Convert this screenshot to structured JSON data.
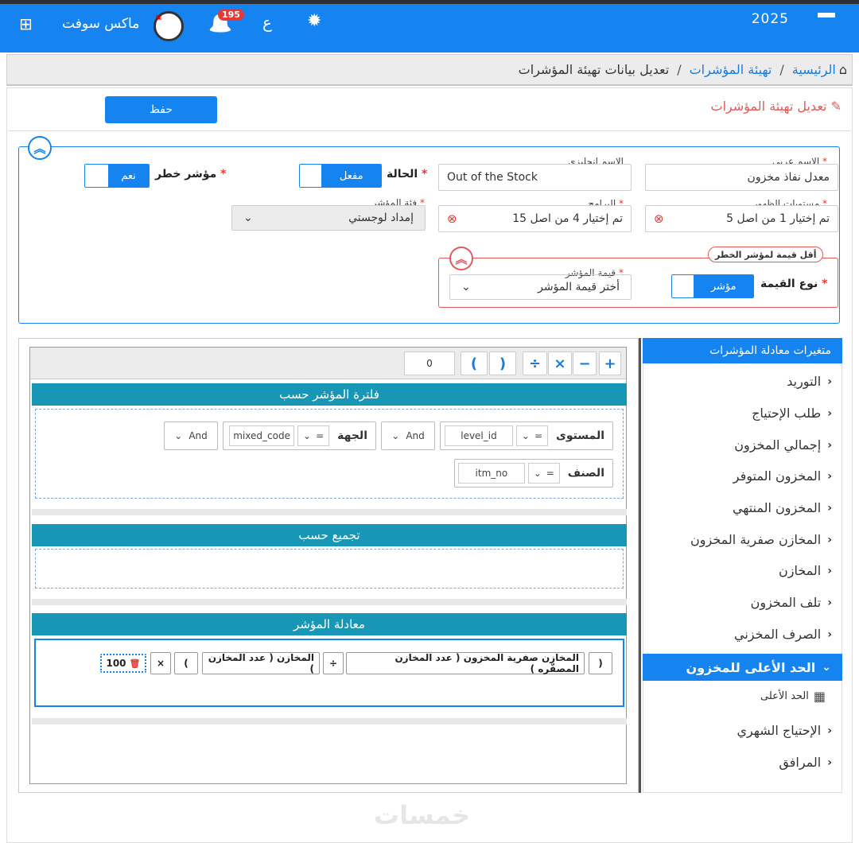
{
  "topbar": {
    "year": "2025",
    "brand": "ماكس سوفت",
    "notification_count": "195",
    "lang_toggle": "ع",
    "gear_glyph": "✹",
    "bell_glyph": "🔔",
    "grid_glyph": "⊞",
    "logo_glyph": "▣"
  },
  "breadcrumb": {
    "home": "الرئيسية",
    "parent": "تهيئة المؤشرات",
    "current": "تعديل بيانات تهيئة المؤشرات",
    "separator": "/",
    "home_glyph": "⌂"
  },
  "page": {
    "title": "تعديل تهيئة المؤشرات",
    "edit_glyph": "✎",
    "save_label": "حفظ"
  },
  "form": {
    "arabic_name_label": "الاسم عربي",
    "arabic_name_value": "معدل نفاذ مخزون",
    "english_name_label": "الاسم إنجليزي",
    "english_name_value": "Out of the Stock",
    "status_label": "الحالة",
    "status_value": "مفعل",
    "risk_label": "مؤشر خطر",
    "risk_value": "نعم",
    "visibility_label": "مستويات الظهور",
    "visibility_value": "تم إختيار 1 من اصل 5",
    "programs_label": "البرامج",
    "programs_value": "تم إختيار 4 من اصل 15",
    "category_label": "فئة المؤشر",
    "category_value": "إمداد لوجستي",
    "required_mark": "*",
    "clear_glyph": "⊗",
    "chevron_glyph": "⌄",
    "collapse_glyph": "︽"
  },
  "risk_section": {
    "legend": "أقل قيمة لمؤشر الخطر",
    "value_type_label": "نوع القيمة",
    "value_type_value": "مؤشر",
    "indicator_value_label": "قيمة المؤشر",
    "indicator_value_placeholder": "أختر قيمة المؤشر"
  },
  "sidebar": {
    "title": "متغيرات معادلة المؤشرات",
    "chevron": "‹",
    "items": [
      "التوريد",
      "طلب الإحتياج",
      "إجمالي المخزون",
      "المخزون المتوفر",
      "المخزون المنتهي",
      "المخازن صفرية المخزون",
      "المخازن",
      "تلف المخزون",
      "الصرف المخزني"
    ],
    "active_item": "الحد الأعلى للمخزون",
    "active_chevron": "⌄",
    "sub_item": "الحد الأعلى",
    "sub_icon": "▦",
    "after_items": [
      "الإحتياج الشهري",
      "المرافق"
    ]
  },
  "toolbar": {
    "plus": "+",
    "minus": "−",
    "times": "×",
    "divide": "÷",
    "paren_close": ")",
    "paren_open": "(",
    "number_value": "0"
  },
  "filter_section": {
    "title": "فلترة المؤشر حسب",
    "row1": {
      "level_label": "المستوى",
      "level_op": "=",
      "level_field": "level_id",
      "and1": "And",
      "entity_label": "الجهة",
      "entity_op": "=",
      "entity_field": "mixed_code",
      "and2": "And"
    },
    "row2": {
      "item_label": "الصنف",
      "item_op": "=",
      "item_field": "itm_no"
    },
    "chev": "⌄"
  },
  "group_section": {
    "title": "تجميع حسب"
  },
  "equation_section": {
    "title": "معادلة المؤشر",
    "tokens": {
      "open1": "(",
      "zero_stores": "المخازن صفرية المخزون ( عدد المخازن المصفّره )",
      "div": "÷",
      "stores": "المخازن ( عدد المخازن )",
      "close1": ")",
      "mul": "×",
      "hundred": "100",
      "del_glyph": "🗑"
    }
  },
  "watermark": "خمسات"
}
